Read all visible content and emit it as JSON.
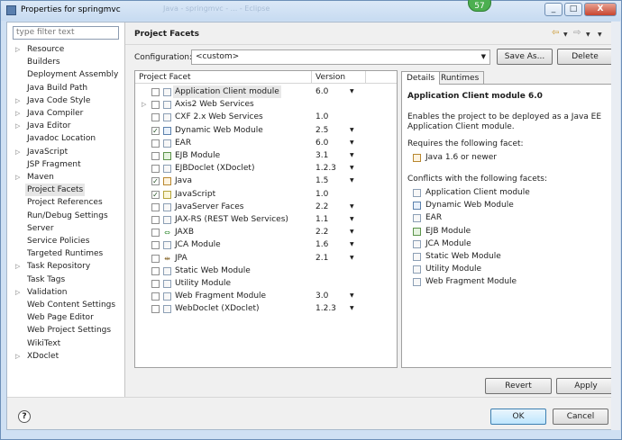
{
  "window": {
    "title": "Properties for springmvc",
    "badge": "57",
    "blurred_title": "Java - springmvc - ... - Eclipse",
    "controls": [
      "_",
      "□",
      "X"
    ]
  },
  "filter": {
    "placeholder": "type filter text"
  },
  "tree": [
    {
      "label": "Resource",
      "expandable": true
    },
    {
      "label": "Builders",
      "expandable": false
    },
    {
      "label": "Deployment Assembly",
      "expandable": false
    },
    {
      "label": "Java Build Path",
      "expandable": false
    },
    {
      "label": "Java Code Style",
      "expandable": true
    },
    {
      "label": "Java Compiler",
      "expandable": true
    },
    {
      "label": "Java Editor",
      "expandable": true
    },
    {
      "label": "Javadoc Location",
      "expandable": false
    },
    {
      "label": "JavaScript",
      "expandable": true
    },
    {
      "label": "JSP Fragment",
      "expandable": false
    },
    {
      "label": "Maven",
      "expandable": true
    },
    {
      "label": "Project Facets",
      "expandable": false,
      "selected": true
    },
    {
      "label": "Project References",
      "expandable": false
    },
    {
      "label": "Run/Debug Settings",
      "expandable": false
    },
    {
      "label": "Server",
      "expandable": false
    },
    {
      "label": "Service Policies",
      "expandable": false
    },
    {
      "label": "Targeted Runtimes",
      "expandable": false
    },
    {
      "label": "Task Repository",
      "expandable": true
    },
    {
      "label": "Task Tags",
      "expandable": false
    },
    {
      "label": "Validation",
      "expandable": true
    },
    {
      "label": "Web Content Settings",
      "expandable": false
    },
    {
      "label": "Web Page Editor",
      "expandable": false
    },
    {
      "label": "Web Project Settings",
      "expandable": false
    },
    {
      "label": "WikiText",
      "expandable": false
    },
    {
      "label": "XDoclet",
      "expandable": true
    }
  ],
  "header": {
    "title": "Project Facets"
  },
  "configuration": {
    "label": "Configuration:",
    "value": "<custom>",
    "save_as": "Save As...",
    "delete": "Delete"
  },
  "facets": {
    "col_facet": "Project Facet",
    "col_version": "Version",
    "rows": [
      {
        "name": "Application Client module",
        "version": "6.0",
        "checked": false,
        "has_dropdown": true,
        "icon": "page",
        "selected": true
      },
      {
        "name": "Axis2 Web Services",
        "version": "",
        "checked": false,
        "has_dropdown": false,
        "icon": "page",
        "expandable": true
      },
      {
        "name": "CXF 2.x Web Services",
        "version": "1.0",
        "checked": false,
        "has_dropdown": false,
        "icon": "page"
      },
      {
        "name": "Dynamic Web Module",
        "version": "2.5",
        "checked": true,
        "has_dropdown": true,
        "icon": "web"
      },
      {
        "name": "EAR",
        "version": "6.0",
        "checked": false,
        "has_dropdown": true,
        "icon": "page"
      },
      {
        "name": "EJB Module",
        "version": "3.1",
        "checked": false,
        "has_dropdown": true,
        "icon": "ejb"
      },
      {
        "name": "EJBDoclet (XDoclet)",
        "version": "1.2.3",
        "checked": false,
        "has_dropdown": true,
        "icon": "page"
      },
      {
        "name": "Java",
        "version": "1.5",
        "checked": true,
        "has_dropdown": true,
        "icon": "java"
      },
      {
        "name": "JavaScript",
        "version": "1.0",
        "checked": true,
        "has_dropdown": false,
        "icon": "js"
      },
      {
        "name": "JavaServer Faces",
        "version": "2.2",
        "checked": false,
        "has_dropdown": true,
        "icon": "page"
      },
      {
        "name": "JAX-RS (REST Web Services)",
        "version": "1.1",
        "checked": false,
        "has_dropdown": true,
        "icon": "page"
      },
      {
        "name": "JAXB",
        "version": "2.2",
        "checked": false,
        "has_dropdown": true,
        "icon": "jaxb"
      },
      {
        "name": "JCA Module",
        "version": "1.6",
        "checked": false,
        "has_dropdown": true,
        "icon": "page"
      },
      {
        "name": "JPA",
        "version": "2.1",
        "checked": false,
        "has_dropdown": true,
        "icon": "jpa"
      },
      {
        "name": "Static Web Module",
        "version": "",
        "checked": false,
        "has_dropdown": false,
        "icon": "page"
      },
      {
        "name": "Utility Module",
        "version": "",
        "checked": false,
        "has_dropdown": false,
        "icon": "page"
      },
      {
        "name": "Web Fragment Module",
        "version": "3.0",
        "checked": false,
        "has_dropdown": true,
        "icon": "page"
      },
      {
        "name": "WebDoclet (XDoclet)",
        "version": "1.2.3",
        "checked": false,
        "has_dropdown": true,
        "icon": "page"
      }
    ]
  },
  "details": {
    "tab_details": "Details",
    "tab_runtimes": "Runtimes",
    "title": "Application Client module 6.0",
    "desc1": "Enables the project to be deployed as a Java EE",
    "desc2": "Application Client module.",
    "requires_label": "Requires the following facet:",
    "requires": [
      {
        "name": "Java 1.6 or newer",
        "icon": "java"
      }
    ],
    "conflicts_label": "Conflicts with the following facets:",
    "conflicts": [
      {
        "name": "Application Client module",
        "icon": "page"
      },
      {
        "name": "Dynamic Web Module",
        "icon": "web"
      },
      {
        "name": "EAR",
        "icon": "page"
      },
      {
        "name": "EJB Module",
        "icon": "ejb"
      },
      {
        "name": "JCA Module",
        "icon": "page"
      },
      {
        "name": "Static Web Module",
        "icon": "page"
      },
      {
        "name": "Utility Module",
        "icon": "page"
      },
      {
        "name": "Web Fragment Module",
        "icon": "page"
      }
    ]
  },
  "buttons": {
    "revert": "Revert",
    "apply": "Apply",
    "ok": "OK",
    "cancel": "Cancel",
    "help": "?"
  },
  "nav_icons": [
    "back-arrow",
    "dropdown",
    "forward-arrow",
    "dropdown",
    "menu-dropdown"
  ]
}
